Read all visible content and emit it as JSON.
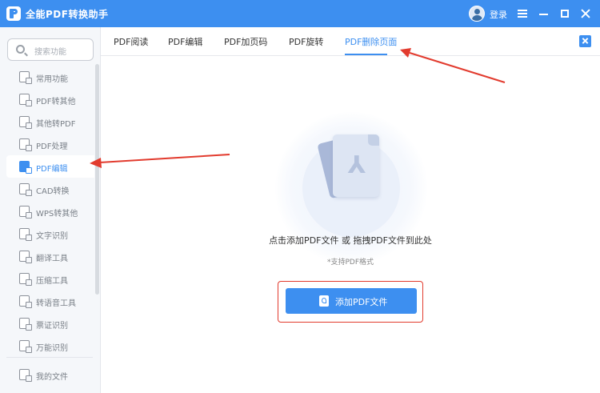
{
  "titlebar": {
    "title": "全能PDF转换助手",
    "login_label": "登录",
    "icons": [
      "avatar-icon",
      "menu-icon",
      "minimize-icon",
      "maximize-icon",
      "close-icon"
    ]
  },
  "sidebar": {
    "search_placeholder": "搜索功能",
    "items": [
      {
        "label": "常用功能"
      },
      {
        "label": "PDF转其他"
      },
      {
        "label": "其他转PDF"
      },
      {
        "label": "PDF处理"
      },
      {
        "label": "PDF编辑"
      },
      {
        "label": "CAD转换"
      },
      {
        "label": "WPS转其他"
      },
      {
        "label": "文字识别"
      },
      {
        "label": "翻译工具"
      },
      {
        "label": "压缩工具"
      },
      {
        "label": "转语音工具"
      },
      {
        "label": "票证识别"
      },
      {
        "label": "万能识别"
      }
    ],
    "files_label": "我的文件"
  },
  "tabs": [
    {
      "label": "PDF阅读"
    },
    {
      "label": "PDF编辑"
    },
    {
      "label": "PDF加页码"
    },
    {
      "label": "PDF旋转"
    },
    {
      "label": "PDF删除页面"
    }
  ],
  "main": {
    "drop_title": "点击添加PDF文件 或 拖拽PDF文件到此处",
    "drop_note": "*支持PDF格式",
    "add_button_label": "添加PDF文件"
  },
  "colors": {
    "accent": "#3d8ff0",
    "annotation": "#e23b2e"
  }
}
